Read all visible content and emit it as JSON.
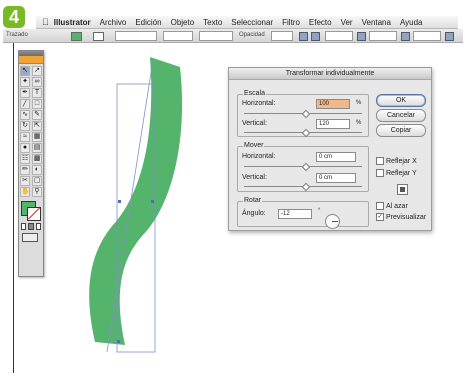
{
  "step_badge": "4",
  "menubar": {
    "apple": "",
    "items": [
      "Illustrator",
      "Archivo",
      "Edición",
      "Objeto",
      "Texto",
      "Seleccionar",
      "Filtro",
      "Efecto",
      "Ver",
      "Ventana",
      "Ayuda"
    ]
  },
  "control_bar": {
    "object_label": "Trazado",
    "opacity_label": "Opacidad"
  },
  "artwork": {
    "shape_color": "#55b46b",
    "selection_color": "#7f8fd0"
  },
  "dialog": {
    "title": "Transformar individualmente",
    "escala": {
      "legend": "Escala",
      "horizontal_label": "Horizontal:",
      "horizontal_value": "100",
      "horizontal_unit": "%",
      "vertical_label": "Vertical:",
      "vertical_value": "120",
      "vertical_unit": "%"
    },
    "mover": {
      "legend": "Mover",
      "horizontal_label": "Horizontal:",
      "horizontal_value": "0 cm",
      "vertical_label": "Vertical:",
      "vertical_value": "0 cm"
    },
    "rotar": {
      "legend": "Rotar",
      "angle_label": "Ángulo:",
      "angle_value": "-12",
      "angle_unit": "°"
    },
    "buttons": {
      "ok": "OK",
      "cancel": "Cancelar",
      "copy": "Copiar"
    },
    "options": {
      "reflect_x": {
        "label": "Reflejar X",
        "checked": false
      },
      "reflect_y": {
        "label": "Reflejar Y",
        "checked": false
      },
      "random": {
        "label": "Al azar",
        "checked": false
      },
      "preview": {
        "label": "Previsualizar",
        "checked": true
      }
    }
  }
}
